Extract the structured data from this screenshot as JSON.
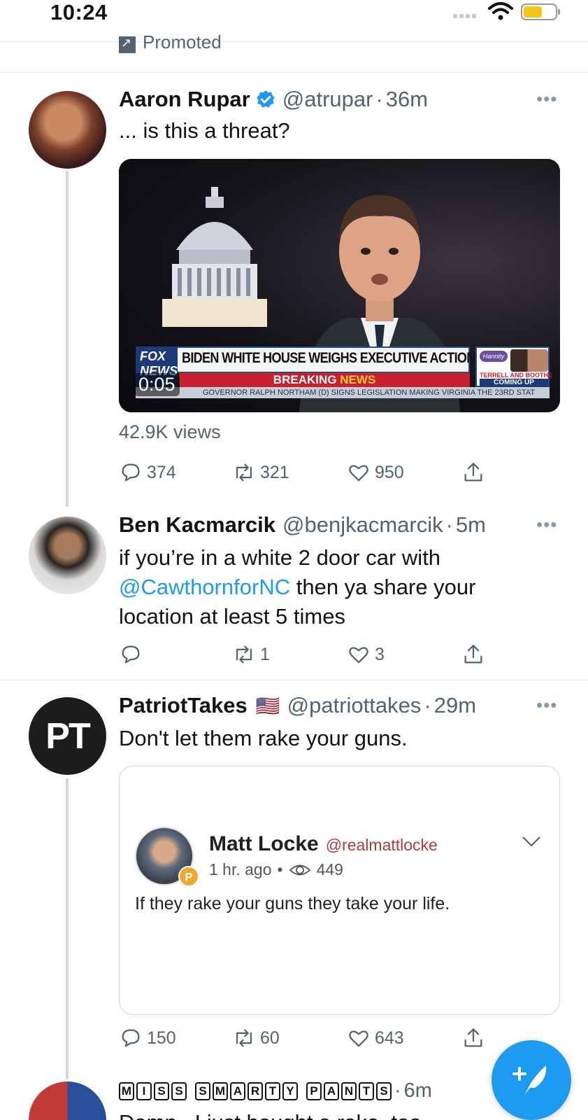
{
  "status_bar": {
    "time": "10:24"
  },
  "promoted": {
    "label": "Promoted"
  },
  "tweets": [
    {
      "name": "Aaron Rupar",
      "handle": "@atrupar",
      "time": "36m",
      "verified": true,
      "text": "... is this a threat?",
      "media": {
        "headline": "BIDEN WHITE HOUSE WEIGHS EXECUTIVE ACTION ON GUNS",
        "breaking": "BREAKING",
        "breaking_news": "NEWS",
        "ticker": "GOVERNOR RALPH NORTHAM (D) SIGNS LEGISLATION MAKING VIRGINIA THE 23RD STAT",
        "network": "FOX NEWS",
        "promo_show": "Hannity",
        "promo_line1": "TERRELL AND BOOTHE",
        "promo_line2": "COMING UP",
        "duration": "0:05"
      },
      "views": "42.9K views",
      "replies": "374",
      "retweets": "321",
      "likes": "950"
    },
    {
      "name": "Ben Kacmarcik",
      "handle": "@benjkacmarcik",
      "time": "5m",
      "text_before": "if you’re in a white 2 door car with",
      "mention": "@CawthornforNC",
      "text_after": "then ya share your",
      "text_line3": "location at least 5 times",
      "replies": "",
      "retweets": "1",
      "likes": "3"
    },
    {
      "name": "PatriotTakes",
      "flag": "🇺🇸",
      "avatar_text": "PT",
      "handle": "@patriottakes",
      "time": "29m",
      "text": "Don't let them rake your guns.",
      "quote": {
        "name": "Matt Locke",
        "handle": "@realmattlocke",
        "time": "1 hr. ago",
        "views": "449",
        "text": "If they rake your guns they take your life.",
        "badge": "P"
      },
      "replies": "150",
      "retweets": "60",
      "likes": "643"
    },
    {
      "name_letters": [
        "M",
        "I",
        "S",
        "S"
      ],
      "name_letters_2": [
        "S",
        "M",
        "A",
        "R",
        "T",
        "Y"
      ],
      "name_letters_3": [
        "P",
        "A",
        "N",
        "T",
        "S"
      ],
      "time": "6m",
      "text": "Damn...I just bought a rake, too."
    }
  ],
  "colors": {
    "accent": "#1d9bf0",
    "secondary_text": "#536471",
    "divider": "#e1e8ed"
  }
}
